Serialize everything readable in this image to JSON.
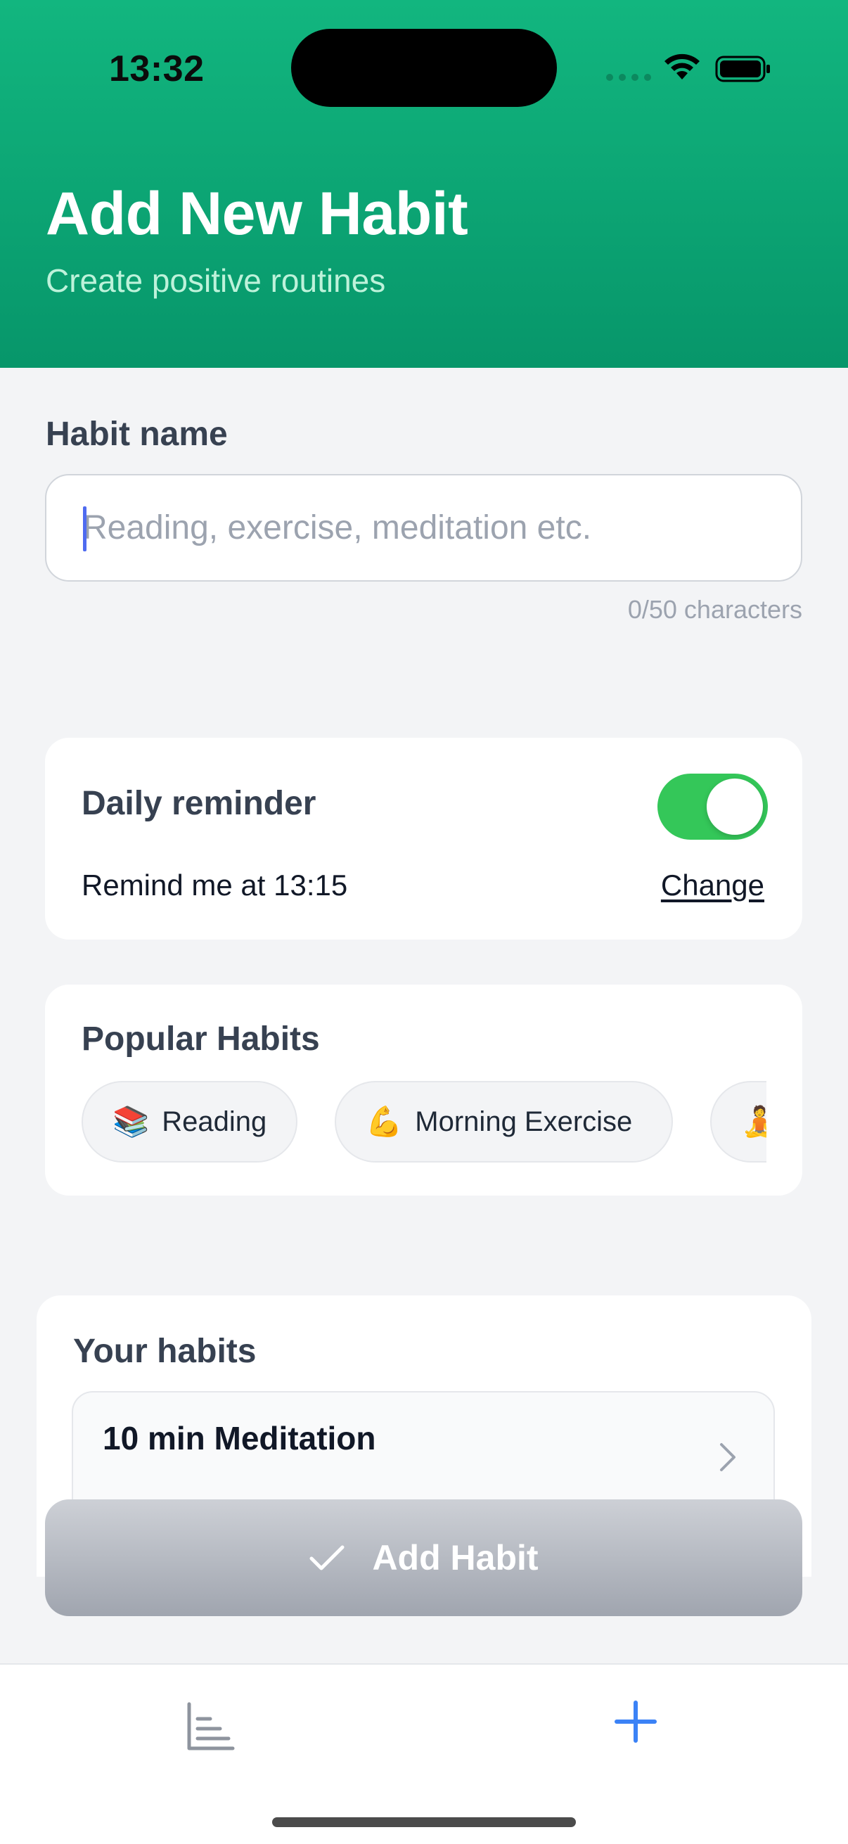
{
  "status_bar": {
    "time": "13:32"
  },
  "header": {
    "title": "Add New Habit",
    "subtitle": "Create positive routines"
  },
  "habit_name": {
    "label": "Habit name",
    "value": "",
    "placeholder": "Reading, exercise, meditation etc.",
    "char_count": "0/50 characters"
  },
  "reminder": {
    "title": "Daily reminder",
    "enabled": true,
    "text": "Remind me at 13:15",
    "change_label": "Change"
  },
  "popular": {
    "title": "Popular Habits",
    "items": [
      {
        "emoji": "📚",
        "label": "Reading"
      },
      {
        "emoji": "💪",
        "label": "Morning Exercise"
      },
      {
        "emoji": "🧘",
        "label": ""
      }
    ]
  },
  "your_habits": {
    "title": "Your habits",
    "items": [
      {
        "name": "10 min Meditation"
      }
    ]
  },
  "add_button": {
    "label": "Add Habit",
    "enabled": false
  },
  "tab_bar": {
    "tabs": [
      {
        "icon": "chart-icon",
        "active": false
      },
      {
        "icon": "plus-icon",
        "active": true
      }
    ]
  },
  "colors": {
    "header_gradient_top": "#12B67F",
    "header_gradient_bottom": "#07966A",
    "toggle_on": "#34C759",
    "active_tab": "#3B82F6",
    "disabled_button": "#A0A5AF"
  }
}
